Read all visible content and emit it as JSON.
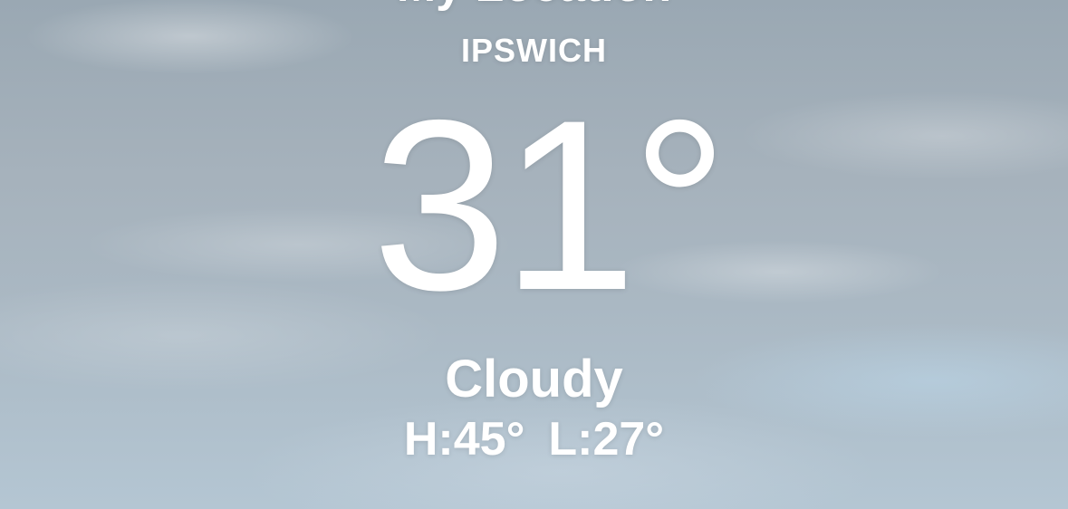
{
  "weather": {
    "location_title": "My Location",
    "city": "IPSWICH",
    "temperature": "31°",
    "condition": "Cloudy",
    "high": "H:45°",
    "low": "L:27°"
  },
  "colors": {
    "text": "#ffffff",
    "sky_top": "#9aa8b3",
    "sky_bottom": "#b4c6d3"
  }
}
